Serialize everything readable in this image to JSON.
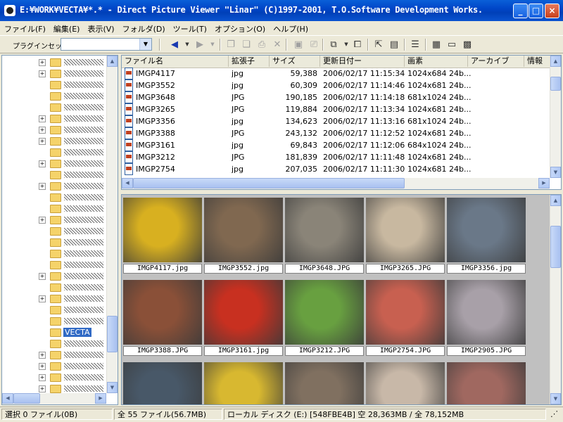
{
  "window": {
    "title": "E:¥WORK¥VECTA¥*.* - Direct Picture Viewer \"Linar\" (C)1997-2001, T.O.Software Development Works.",
    "minimize": "_",
    "maximize": "□",
    "close": "×"
  },
  "menu": [
    {
      "label": "ファイル(F)"
    },
    {
      "label": "編集(E)"
    },
    {
      "label": "表示(V)"
    },
    {
      "label": "フォルダ(D)"
    },
    {
      "label": "ツール(T)"
    },
    {
      "label": "オプション(O)"
    },
    {
      "label": "ヘルプ(H)"
    }
  ],
  "toolbar": {
    "plugin_label": "プラグインセット:",
    "plugin_value": "",
    "icons": [
      "back-icon",
      "forward-icon",
      "copy-icon",
      "paste-icon",
      "move-icon",
      "delete-icon",
      "save-icon",
      "print-icon",
      "view-mode-icon",
      "window-icon",
      "select-icon",
      "thumbnail-icon",
      "list-view-icon",
      "slideshow-icon",
      "folder-open-icon",
      "grid-icon"
    ]
  },
  "tree": {
    "selected_folder": "VECTA"
  },
  "list": {
    "columns": [
      "ファイル名",
      "拡張子",
      "サイズ",
      "更新日付ー",
      "画素",
      "アーカイブ",
      "情報"
    ],
    "rows": [
      {
        "name": "IMGP4117",
        "ext": "jpg",
        "size": "59,388",
        "date": "2006/02/17 11:15:34",
        "pixels": "1024x684 24b..."
      },
      {
        "name": "IMGP3552",
        "ext": "jpg",
        "size": "60,309",
        "date": "2006/02/17 11:14:46",
        "pixels": "1024x681 24b..."
      },
      {
        "name": "IMGP3648",
        "ext": "JPG",
        "size": "190,185",
        "date": "2006/02/17 11:14:18",
        "pixels": "681x1024 24b..."
      },
      {
        "name": "IMGP3265",
        "ext": "JPG",
        "size": "119,884",
        "date": "2006/02/17 11:13:34",
        "pixels": "1024x681 24b..."
      },
      {
        "name": "IMGP3356",
        "ext": "jpg",
        "size": "134,623",
        "date": "2006/02/17 11:13:16",
        "pixels": "681x1024 24b..."
      },
      {
        "name": "IMGP3388",
        "ext": "JPG",
        "size": "243,132",
        "date": "2006/02/17 11:12:52",
        "pixels": "1024x681 24b..."
      },
      {
        "name": "IMGP3161",
        "ext": "jpg",
        "size": "69,843",
        "date": "2006/02/17 11:12:06",
        "pixels": "684x1024 24b..."
      },
      {
        "name": "IMGP3212",
        "ext": "JPG",
        "size": "181,839",
        "date": "2006/02/17 11:11:48",
        "pixels": "1024x681 24b..."
      },
      {
        "name": "IMGP2754",
        "ext": "jpg",
        "size": "207,035",
        "date": "2006/02/17 11:11:30",
        "pixels": "1024x681 24b..."
      }
    ]
  },
  "thumbnails": [
    {
      "caption": "IMGP4117.jpg",
      "color": "#d8b020"
    },
    {
      "caption": "IMGP3552.jpg",
      "color": "#806850"
    },
    {
      "caption": "IMGP3648.JPG",
      "color": "#8a8478"
    },
    {
      "caption": "IMGP3265.JPG",
      "color": "#c8b8a0"
    },
    {
      "caption": "IMGP3356.jpg",
      "color": "#6a7888"
    },
    {
      "caption": "IMGP3388.JPG",
      "color": "#8a5038"
    },
    {
      "caption": "IMGP3161.jpg",
      "color": "#c83020"
    },
    {
      "caption": "IMGP3212.JPG",
      "color": "#68a040"
    },
    {
      "caption": "IMGP2754.JPG",
      "color": "#c86050"
    },
    {
      "caption": "IMGP2905.JPG",
      "color": "#a8a0a8"
    },
    {
      "caption": "",
      "color": "#485868"
    },
    {
      "caption": "",
      "color": "#d8b830"
    },
    {
      "caption": "",
      "color": "#807060"
    },
    {
      "caption": "",
      "color": "#c8b8a8"
    },
    {
      "caption": "",
      "color": "#a06860"
    }
  ],
  "status": {
    "selected": "選択 0 ファイル(0B)",
    "total": "全 55 ファイル(56.7MB)",
    "disk": "ローカル ディスク (E:) [548FBE4B] 空 28,363MB / 全 78,152MB"
  }
}
